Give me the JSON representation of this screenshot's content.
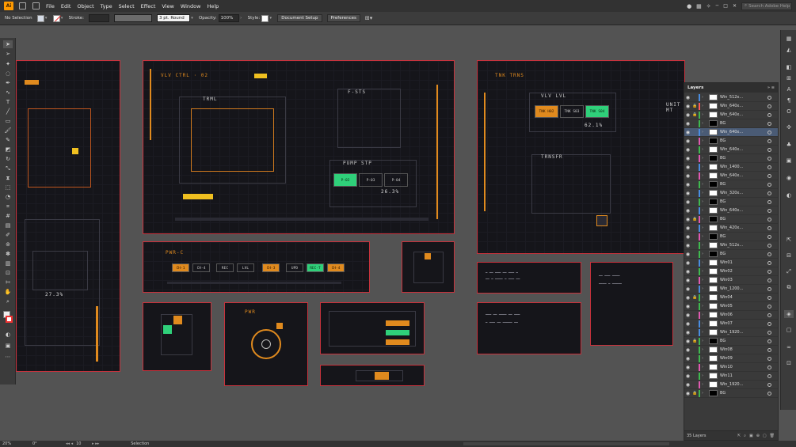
{
  "app": {
    "logo": "Ai"
  },
  "menu": [
    "File",
    "Edit",
    "Object",
    "Type",
    "Select",
    "Effect",
    "View",
    "Window",
    "Help"
  ],
  "search": {
    "placeholder": "Search Adobe Help"
  },
  "control": {
    "selection": "No Selection",
    "stroke_label": "Stroke:",
    "stroke_value": "",
    "brush": "3 pt. Round",
    "opacity_label": "Opacity:",
    "opacity_value": "100%",
    "style_label": "Style:",
    "document_setup": "Document Setup",
    "preferences": "Preferences"
  },
  "layers_panel": {
    "title": "Layers",
    "count": "35 Layers",
    "rows": [
      {
        "name": "Win_512x...",
        "color": "#4a8de0",
        "locked": false
      },
      {
        "name": "Win_640x...",
        "color": "#ff5a5a",
        "locked": true
      },
      {
        "name": "Win_640x...",
        "color": "#3fb94f",
        "locked": true
      },
      {
        "name": "BG",
        "color": "#3fb94f",
        "locked": false
      },
      {
        "name": "Win_640x...",
        "color": "#4a8de0",
        "locked": false,
        "selected": true
      },
      {
        "name": "BG",
        "color": "#e05ab0",
        "locked": false
      },
      {
        "name": "Win_640x...",
        "color": "#3fb94f",
        "locked": false
      },
      {
        "name": "BG",
        "color": "#e05ab0",
        "locked": false
      },
      {
        "name": "Win_1400...",
        "color": "#4a8de0",
        "locked": false
      },
      {
        "name": "Win_640x...",
        "color": "#e05ab0",
        "locked": false
      },
      {
        "name": "BG",
        "color": "#3fb94f",
        "locked": false
      },
      {
        "name": "Win_320x...",
        "color": "#4a8de0",
        "locked": false
      },
      {
        "name": "BG",
        "color": "#3fb94f",
        "locked": false
      },
      {
        "name": "Win_640x...",
        "color": "#4a8de0",
        "locked": false
      },
      {
        "name": "BG",
        "color": "#e05ab0",
        "locked": true
      },
      {
        "name": "Win_420x...",
        "color": "#4a8de0",
        "locked": false
      },
      {
        "name": "BG",
        "color": "#e05ab0",
        "locked": false
      },
      {
        "name": "Win_512x...",
        "color": "#3fb94f",
        "locked": false
      },
      {
        "name": "BG",
        "color": "#3fb94f",
        "locked": false
      },
      {
        "name": "Win01",
        "color": "#4a8de0",
        "locked": false
      },
      {
        "name": "Win02",
        "color": "#3fb94f",
        "locked": false
      },
      {
        "name": "Win03",
        "color": "#e05ab0",
        "locked": false
      },
      {
        "name": "Win_1200...",
        "color": "#4a8de0",
        "locked": false
      },
      {
        "name": "Win04",
        "color": "#3fb94f",
        "locked": true
      },
      {
        "name": "Win05",
        "color": "#3fb94f",
        "locked": false
      },
      {
        "name": "Win06",
        "color": "#e05ab0",
        "locked": false
      },
      {
        "name": "Win07",
        "color": "#4a8de0",
        "locked": false
      },
      {
        "name": "Win_1920...",
        "color": "#4a8de0",
        "locked": false
      },
      {
        "name": "BG",
        "color": "#3fb94f",
        "locked": true
      },
      {
        "name": "Win08",
        "color": "#3fb94f",
        "locked": false
      },
      {
        "name": "Win09",
        "color": "#3fb94f",
        "locked": false
      },
      {
        "name": "Win10",
        "color": "#e05ab0",
        "locked": false
      },
      {
        "name": "Win11",
        "color": "#3fb94f",
        "locked": false
      },
      {
        "name": "Win_1920...",
        "color": "#e05ab0",
        "locked": false
      },
      {
        "name": "BG",
        "color": "#3fb94f",
        "locked": true
      }
    ]
  },
  "artboards": {
    "vlv_title": "VLV CTRL · 02",
    "trml": "TRML",
    "fsts": "F-STS",
    "pump": "PUMP STP",
    "pump_vals": [
      "P-02",
      "P-03",
      "P-04"
    ],
    "pump_pct": "26.3%",
    "tnk_title": "TNK TRNS",
    "vlv_lvl": "VLV LVL",
    "tnk_cells": [
      "TNK H02",
      "TNK S03",
      "TNK S04"
    ],
    "tnk_pct": "62.1%",
    "trnsfr": "TRNSFR",
    "unit": "UNIT MT",
    "left_pct": "27.3%",
    "pwr_title": "PWR-C",
    "pwr_cells": [
      "CH-1",
      "CH-4",
      "REC",
      "LVL",
      "CH-3",
      "UPD",
      "REC-T",
      "CH-4"
    ],
    "pwr2": "PWR"
  },
  "status": {
    "zoom": "20%",
    "rotate": "0°",
    "artboard": "10",
    "tool": "Selection"
  }
}
